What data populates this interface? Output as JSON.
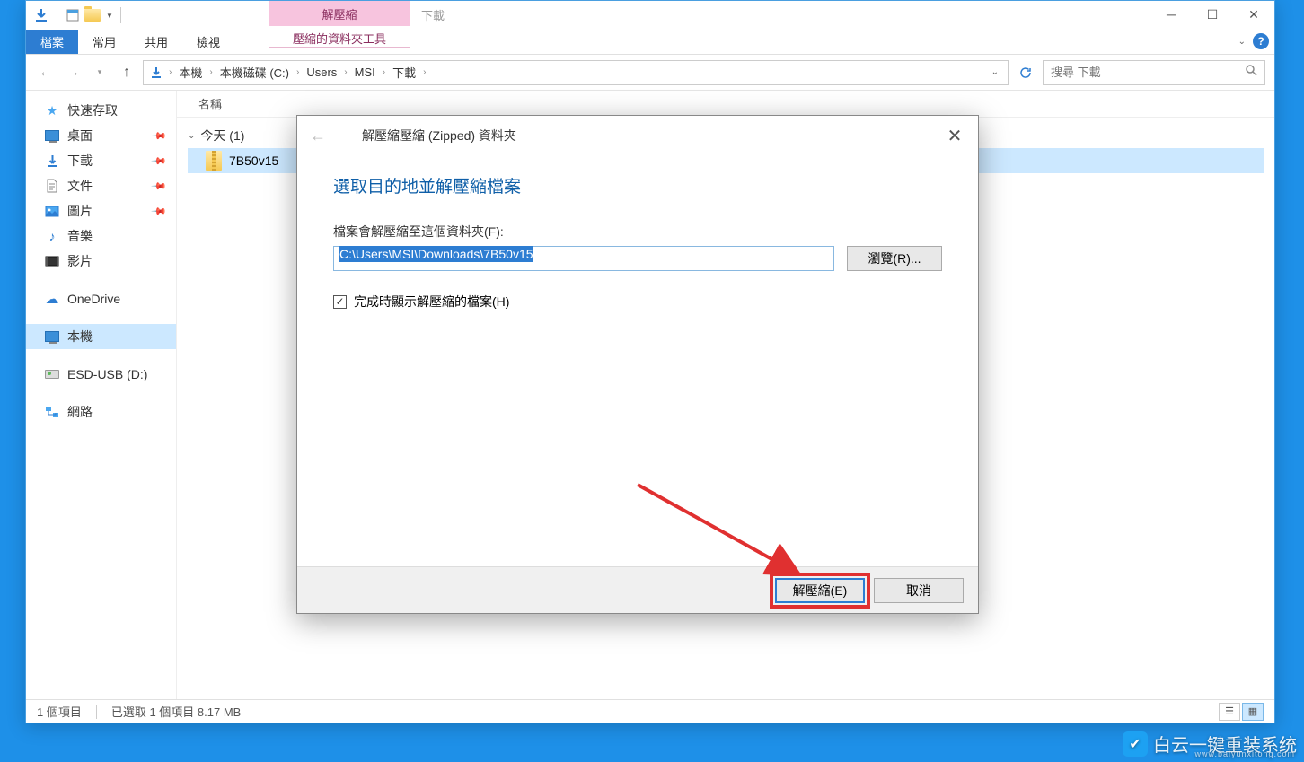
{
  "window": {
    "contextual_tab_header": "解壓縮",
    "title": "下載",
    "tabs": {
      "file": "檔案",
      "home": "常用",
      "share": "共用",
      "view": "檢視",
      "compressed": "壓縮的資料夾工具"
    }
  },
  "nav": {
    "breadcrumb": [
      "本機",
      "本機磁碟 (C:)",
      "Users",
      "MSI",
      "下載"
    ],
    "search_placeholder": "搜尋 下載"
  },
  "sidebar": {
    "quick_access": "快速存取",
    "desktop": "桌面",
    "downloads": "下載",
    "documents": "文件",
    "pictures": "圖片",
    "music": "音樂",
    "videos": "影片",
    "onedrive": "OneDrive",
    "this_pc": "本機",
    "esd_usb": "ESD-USB (D:)",
    "network": "網路"
  },
  "file_list": {
    "column_name": "名稱",
    "group_today": "今天 (1)",
    "file1": "7B50v15"
  },
  "status": {
    "items": "1 個項目",
    "selected": "已選取 1 個項目 8.17 MB"
  },
  "dialog": {
    "title": "解壓縮壓縮 (Zipped) 資料夾",
    "heading": "選取目的地並解壓縮檔案",
    "path_label": "檔案會解壓縮至這個資料夾(F):",
    "path_value": "C:\\Users\\MSI\\Downloads\\7B50v15",
    "browse": "瀏覽(R)...",
    "show_files": "完成時顯示解壓縮的檔案(H)",
    "extract": "解壓縮(E)",
    "cancel": "取消"
  },
  "watermark": {
    "text": "白云一键重装系统",
    "url": "www.baiyunxitong.com"
  }
}
